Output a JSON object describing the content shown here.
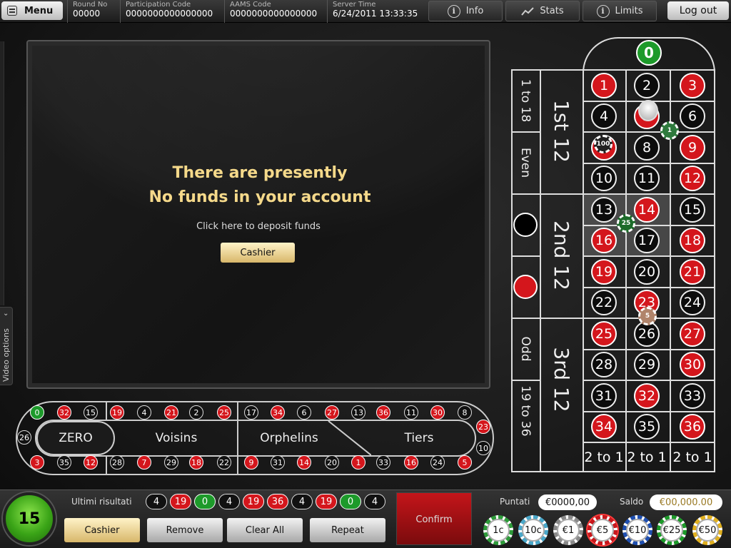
{
  "topbar": {
    "menu_label": "Menu",
    "round_label": "Round No",
    "round_value": "00000",
    "participation_label": "Participation Code",
    "participation_value": "0000000000000000",
    "aams_label": "AAMS Code",
    "aams_value": "0000000000000000",
    "server_label": "Server Time",
    "server_value": "6/24/2011 13:33:35",
    "info_label": "Info",
    "stats_label": "Stats",
    "limits_label": "Limits",
    "logout_label": "Log out"
  },
  "video": {
    "options_label": "Video options",
    "message_line1": "There are presently",
    "message_line2": "No funds in your account",
    "deposit_text": "Click here to deposit funds",
    "cashier_label": "Cashier"
  },
  "racetrack": {
    "sectors": [
      "ZERO",
      "Voisins",
      "Orphelins",
      "Tiers"
    ],
    "top_numbers": [
      {
        "n": "0",
        "c": "green"
      },
      {
        "n": "32",
        "c": "red"
      },
      {
        "n": "15",
        "c": "black"
      },
      {
        "n": "19",
        "c": "red"
      },
      {
        "n": "4",
        "c": "black"
      },
      {
        "n": "21",
        "c": "red"
      },
      {
        "n": "2",
        "c": "black"
      },
      {
        "n": "25",
        "c": "red"
      },
      {
        "n": "17",
        "c": "black"
      },
      {
        "n": "34",
        "c": "red"
      },
      {
        "n": "6",
        "c": "black"
      },
      {
        "n": "27",
        "c": "red"
      },
      {
        "n": "13",
        "c": "black"
      },
      {
        "n": "36",
        "c": "red"
      },
      {
        "n": "11",
        "c": "black"
      },
      {
        "n": "30",
        "c": "red"
      },
      {
        "n": "8",
        "c": "black"
      }
    ],
    "bottom_numbers": [
      {
        "n": "3",
        "c": "red"
      },
      {
        "n": "35",
        "c": "black"
      },
      {
        "n": "12",
        "c": "red"
      },
      {
        "n": "28",
        "c": "black"
      },
      {
        "n": "7",
        "c": "red"
      },
      {
        "n": "29",
        "c": "black"
      },
      {
        "n": "18",
        "c": "red"
      },
      {
        "n": "22",
        "c": "black"
      },
      {
        "n": "9",
        "c": "red"
      },
      {
        "n": "31",
        "c": "black"
      },
      {
        "n": "14",
        "c": "red"
      },
      {
        "n": "20",
        "c": "black"
      },
      {
        "n": "1",
        "c": "red"
      },
      {
        "n": "33",
        "c": "black"
      },
      {
        "n": "16",
        "c": "red"
      },
      {
        "n": "24",
        "c": "black"
      },
      {
        "n": "5",
        "c": "red"
      }
    ],
    "left_number": {
      "n": "26",
      "c": "black"
    },
    "right_numbers": [
      {
        "n": "23",
        "c": "red"
      },
      {
        "n": "10",
        "c": "black"
      }
    ]
  },
  "table": {
    "zero": "0",
    "rows": [
      [
        {
          "n": "1",
          "c": "red"
        },
        {
          "n": "2",
          "c": "black"
        },
        {
          "n": "3",
          "c": "red"
        }
      ],
      [
        {
          "n": "4",
          "c": "black"
        },
        {
          "n": "5",
          "c": "red"
        },
        {
          "n": "6",
          "c": "black"
        }
      ],
      [
        {
          "n": "7",
          "c": "red"
        },
        {
          "n": "8",
          "c": "black"
        },
        {
          "n": "9",
          "c": "red"
        }
      ],
      [
        {
          "n": "10",
          "c": "black"
        },
        {
          "n": "11",
          "c": "black"
        },
        {
          "n": "12",
          "c": "red"
        }
      ],
      [
        {
          "n": "13",
          "c": "black"
        },
        {
          "n": "14",
          "c": "red"
        },
        {
          "n": "15",
          "c": "black"
        }
      ],
      [
        {
          "n": "16",
          "c": "red"
        },
        {
          "n": "17",
          "c": "black"
        },
        {
          "n": "18",
          "c": "red"
        }
      ],
      [
        {
          "n": "19",
          "c": "red"
        },
        {
          "n": "20",
          "c": "black"
        },
        {
          "n": "21",
          "c": "red"
        }
      ],
      [
        {
          "n": "22",
          "c": "black"
        },
        {
          "n": "23",
          "c": "red"
        },
        {
          "n": "24",
          "c": "black"
        }
      ],
      [
        {
          "n": "25",
          "c": "red"
        },
        {
          "n": "26",
          "c": "black"
        },
        {
          "n": "27",
          "c": "red"
        }
      ],
      [
        {
          "n": "28",
          "c": "black"
        },
        {
          "n": "29",
          "c": "black"
        },
        {
          "n": "30",
          "c": "red"
        }
      ],
      [
        {
          "n": "31",
          "c": "black"
        },
        {
          "n": "32",
          "c": "red"
        },
        {
          "n": "33",
          "c": "black"
        }
      ],
      [
        {
          "n": "34",
          "c": "red"
        },
        {
          "n": "35",
          "c": "black"
        },
        {
          "n": "36",
          "c": "red"
        }
      ]
    ],
    "dozens": [
      "1st 12",
      "2nd 12",
      "3rd 12"
    ],
    "outside": [
      "1 to 18",
      "Even",
      "Odd",
      "19 to 36"
    ],
    "columns": [
      "2 to 1",
      "2 to 1",
      "2 to 1"
    ],
    "chips_on_table": [
      "1",
      "100",
      "25",
      "5"
    ]
  },
  "bottom": {
    "timer": "15",
    "ultimi_label": "Ultimi risultati",
    "results": [
      {
        "n": "4",
        "c": "black"
      },
      {
        "n": "19",
        "c": "red"
      },
      {
        "n": "0",
        "c": "green"
      },
      {
        "n": "4",
        "c": "black"
      },
      {
        "n": "19",
        "c": "red"
      },
      {
        "n": "36",
        "c": "red"
      },
      {
        "n": "4",
        "c": "black"
      },
      {
        "n": "19",
        "c": "red"
      },
      {
        "n": "0",
        "c": "green"
      },
      {
        "n": "4",
        "c": "black"
      }
    ],
    "cashier_label": "Cashier",
    "remove_label": "Remove",
    "clear_label": "Clear All",
    "repeat_label": "Repeat",
    "confirm_label": "Confirm",
    "puntati_label": "Puntati",
    "puntati_value": "€0000,00",
    "saldo_label": "Saldo",
    "saldo_value": "€00,000.00",
    "chips": [
      {
        "label": "1c",
        "color": "#2e9b3a"
      },
      {
        "label": "10c",
        "color": "#4aa7c9"
      },
      {
        "label": "€1",
        "color": "#8a8a8a"
      },
      {
        "label": "€5",
        "color": "#c8171c"
      },
      {
        "label": "€10",
        "color": "#1f4fb0"
      },
      {
        "label": "€25",
        "color": "#1d9a2a"
      },
      {
        "label": "€50",
        "color": "#e0b020"
      }
    ]
  }
}
